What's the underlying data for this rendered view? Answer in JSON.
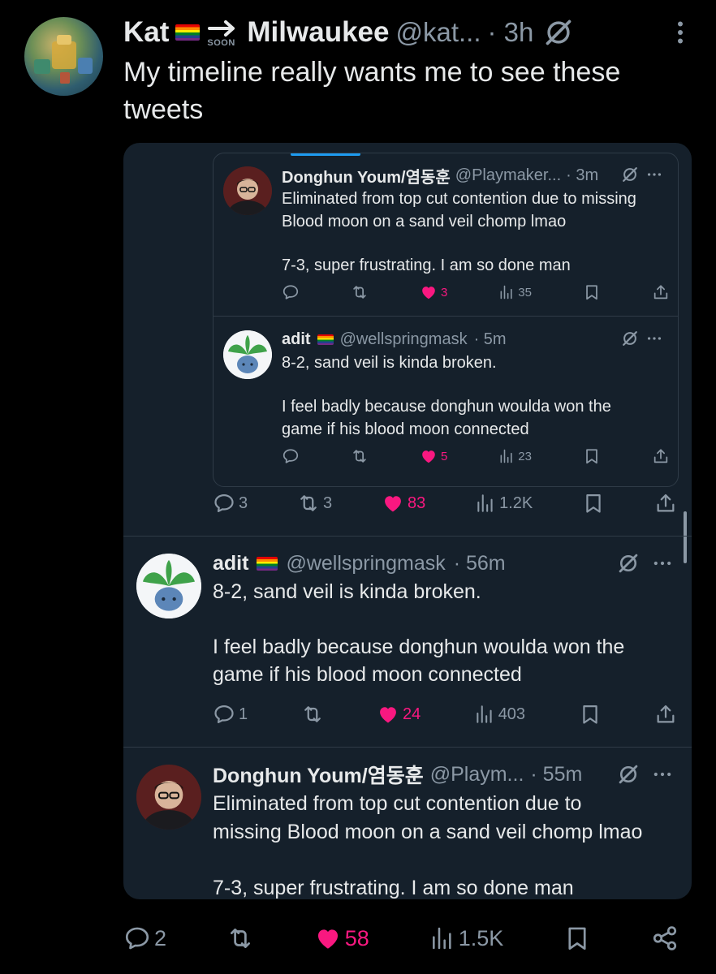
{
  "main_tweet": {
    "name": "Kat",
    "soon_label": "SOON",
    "location": "Milwaukee",
    "handle": "@kat...",
    "time": "· 3h",
    "text_line1": "My timeline really wants me to see these",
    "text_line2": "tweets",
    "actions": {
      "replies": "2",
      "likes": "58",
      "views": "1.5K"
    }
  },
  "screenshot": {
    "quote1": {
      "name": "Donghun Youm/염동훈",
      "handle": "@Playmaker...",
      "time": "· 3m",
      "line1": "Eliminated from top cut contention due to missing",
      "line2": "Blood moon on a sand veil chomp lmao",
      "line3": "7-3, super frustrating. I am so done man",
      "likes": "3",
      "views": "35"
    },
    "quote2": {
      "name": "adit",
      "handle": "@wellspringmask",
      "time": "· 5m",
      "line1": "8-2, sand veil is kinda broken.",
      "line2": "I feel badly because donghun woulda won the",
      "line3": "game if his blood moon connected",
      "likes": "5",
      "views": "23"
    },
    "outer_actions": {
      "replies": "3",
      "reposts": "3",
      "likes": "83",
      "views": "1.2K"
    },
    "tweet2": {
      "name": "adit",
      "handle": "@wellspringmask",
      "time": "· 56m",
      "line1": "8-2, sand veil is kinda broken.",
      "line2": "I feel badly because donghun woulda won the",
      "line3": "game if his blood moon connected",
      "replies": "1",
      "likes": "24",
      "views": "403"
    },
    "tweet3": {
      "name": "Donghun Youm/염동훈",
      "handle": "@Playm...",
      "time": "· 55m",
      "line1": "Eliminated from top cut contention due to",
      "line2": "missing Blood moon on a sand veil chomp lmao",
      "line3": "7-3, super frustrating. I am so done man"
    }
  },
  "colors": {
    "like_pink": "#f91880",
    "muted": "#8b98a5",
    "card_bg": "#15202b",
    "link_blue": "#1d9bf0"
  }
}
